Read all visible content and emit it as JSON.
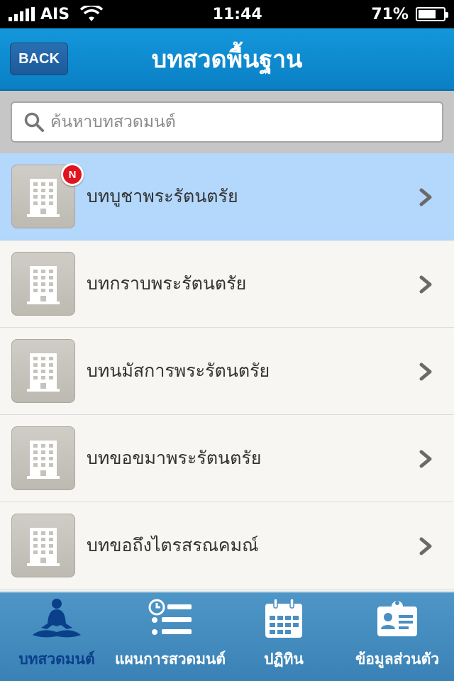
{
  "status_bar": {
    "carrier": "AIS",
    "time": "11:44",
    "battery": "71%",
    "battery_level": 0.71
  },
  "header": {
    "back_label": "BACK",
    "title": "บทสวดพื้นฐาน"
  },
  "search": {
    "placeholder": "ค้นหาบทสวดมนต์",
    "value": ""
  },
  "list": {
    "items": [
      {
        "label": "บทบูชาพระรัตนตรัย",
        "badge": "N",
        "icon": "building-icon",
        "active": true
      },
      {
        "label": "บทกราบพระรัตนตรัย",
        "icon": "building-icon"
      },
      {
        "label": "บทนมัสการพระรัตนตรัย",
        "icon": "building-icon"
      },
      {
        "label": "บทขอขมาพระรัตนตรัย",
        "icon": "building-icon"
      },
      {
        "label": "บทขอถึงไตรสรณคมณ์",
        "icon": "building-icon"
      }
    ]
  },
  "tabs": [
    {
      "label": "บทสวดมนต์",
      "icon": "meditation-icon",
      "active": true
    },
    {
      "label": "แผนการสวดมนต์",
      "icon": "schedule-list-icon"
    },
    {
      "label": "ปฏิทิน",
      "icon": "calendar-icon"
    },
    {
      "label": "ข้อมูลส่วนตัว",
      "icon": "id-card-icon"
    }
  ],
  "colors": {
    "header": "#0a8ad0",
    "active_row": "#b3d8fc",
    "tab_bar": "#4a8fc2",
    "active_tab": "#0a3f8a",
    "badge": "#e0141e"
  }
}
